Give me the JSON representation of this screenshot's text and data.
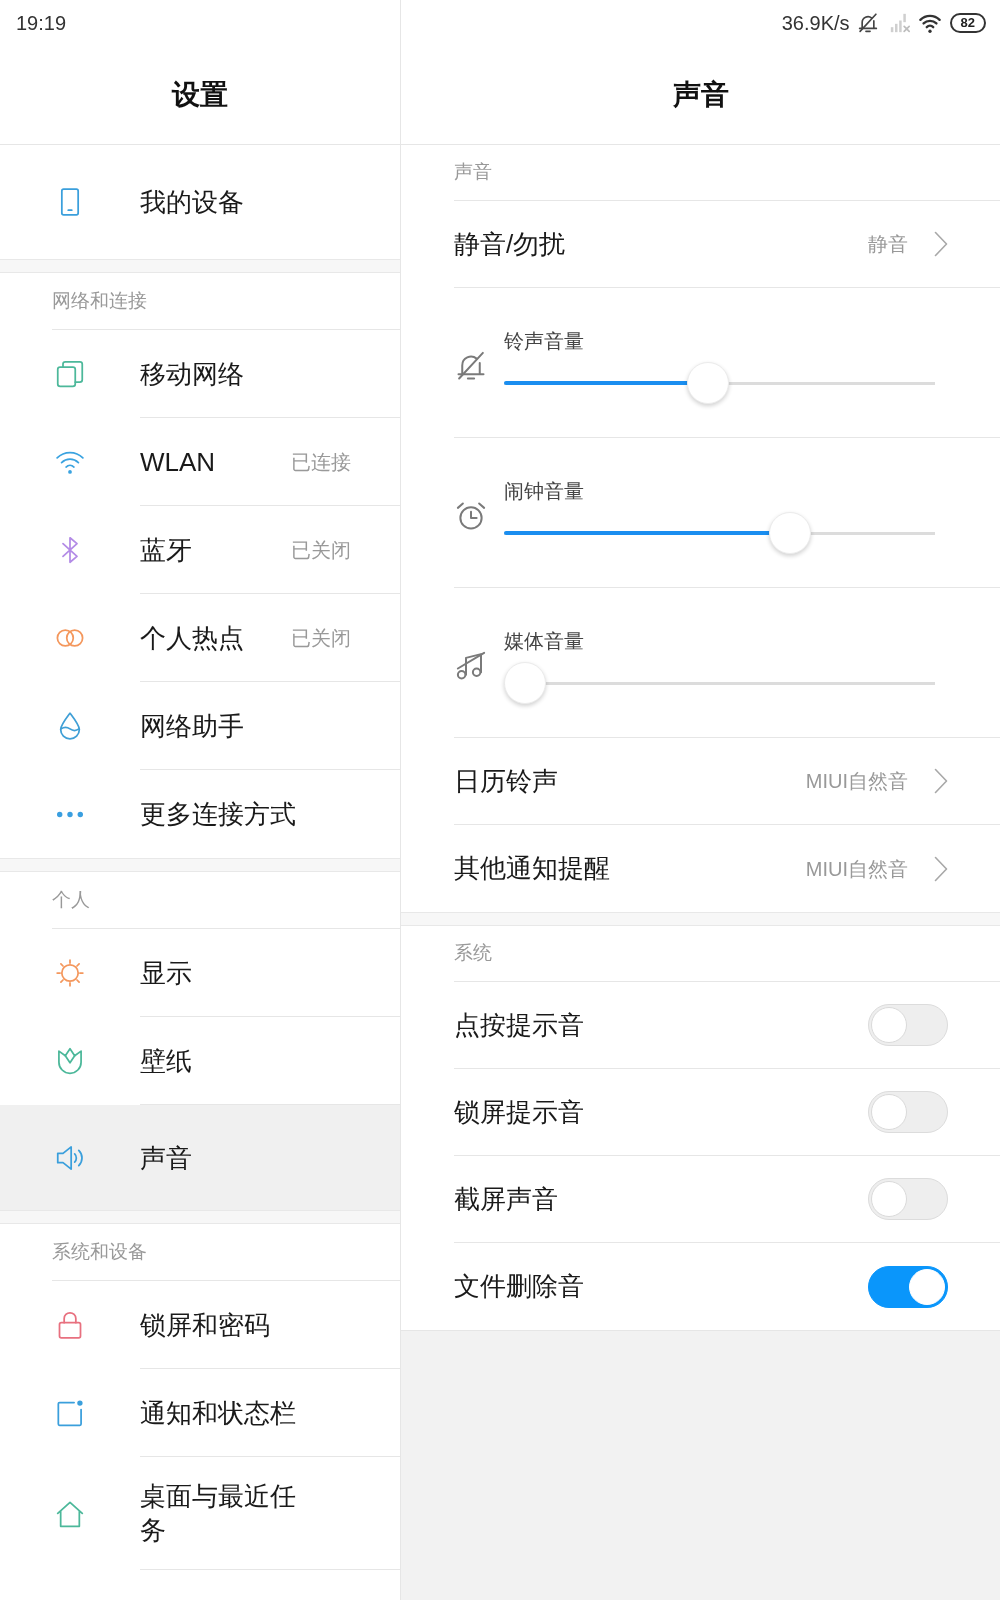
{
  "status_bar": {
    "time": "19:19",
    "net_speed": "36.9K/s",
    "battery": "82"
  },
  "settings_panel": {
    "title": "设置",
    "groups": [
      {
        "items": [
          {
            "label": "我的设备",
            "selected": false
          }
        ]
      },
      {
        "header": "网络和连接",
        "items": [
          {
            "label": "移动网络",
            "selected": false
          },
          {
            "label": "WLAN",
            "status": "已连接",
            "selected": false
          },
          {
            "label": "蓝牙",
            "status": "已关闭",
            "selected": false
          },
          {
            "label": "个人热点",
            "status": "已关闭",
            "selected": false
          },
          {
            "label": "网络助手",
            "selected": false
          },
          {
            "label": "更多连接方式",
            "selected": false
          }
        ]
      },
      {
        "header": "个人",
        "items": [
          {
            "label": "显示",
            "selected": false
          },
          {
            "label": "壁纸",
            "selected": false
          },
          {
            "label": "声音",
            "selected": true
          }
        ]
      },
      {
        "header": "系统和设备",
        "items": [
          {
            "label": "锁屏和密码",
            "selected": false
          },
          {
            "label": "通知和状态栏",
            "selected": false
          },
          {
            "label": "桌面与最近任务",
            "selected": false
          }
        ]
      }
    ]
  },
  "sound_panel": {
    "title": "声音",
    "sections": [
      {
        "header": "声音",
        "rows": [
          {
            "kind": "link",
            "label": "静音/勿扰",
            "value": "静音"
          },
          {
            "kind": "slider",
            "label": "铃声音量",
            "level": 0.47
          },
          {
            "kind": "slider",
            "label": "闹钟音量",
            "level": 0.68
          },
          {
            "kind": "slider",
            "label": "媒体音量",
            "level": 0
          },
          {
            "kind": "link",
            "label": "日历铃声",
            "value": "MIUI自然音"
          },
          {
            "kind": "link",
            "label": "其他通知提醒",
            "value": "MIUI自然音"
          }
        ]
      },
      {
        "header": "系统",
        "rows": [
          {
            "kind": "toggle",
            "label": "点按提示音",
            "on": false
          },
          {
            "kind": "toggle",
            "label": "锁屏提示音",
            "on": false
          },
          {
            "kind": "toggle",
            "label": "截屏声音",
            "on": false
          },
          {
            "kind": "toggle",
            "label": "文件删除音",
            "on": true
          }
        ]
      }
    ]
  }
}
